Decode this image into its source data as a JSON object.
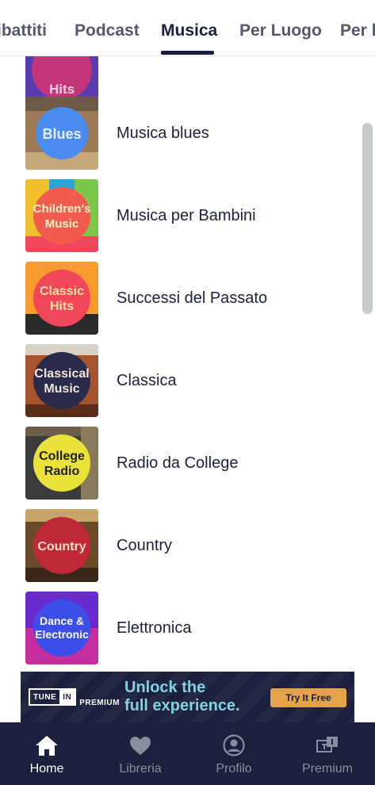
{
  "tabs": {
    "items": [
      {
        "label": "ibattiti",
        "active": false
      },
      {
        "label": "Podcast",
        "active": false
      },
      {
        "label": "Musica",
        "active": true
      },
      {
        "label": "Per Luogo",
        "active": false
      },
      {
        "label": "Per li",
        "active": false
      }
    ]
  },
  "list": {
    "items": [
      {
        "label": "",
        "thumb_text": [
          "Hits"
        ],
        "thumb_colors": [
          "#c2357b",
          "#5b3bb0"
        ]
      },
      {
        "label": "Musica blues",
        "thumb_text": [
          "Blues"
        ],
        "thumb_colors": [
          "#4a8cf0",
          "#9b7a55"
        ]
      },
      {
        "label": "Musica per Bambini",
        "thumb_text": [
          "Children's",
          "Music"
        ],
        "thumb_colors": [
          "#f25c4e",
          "#2aa7d8"
        ]
      },
      {
        "label": "Successi del Passato",
        "thumb_text": [
          "Classic",
          "Hits"
        ],
        "thumb_colors": [
          "#f2465a",
          "#f79b2e"
        ]
      },
      {
        "label": "Classica",
        "thumb_text": [
          "Classical",
          "Music"
        ],
        "thumb_colors": [
          "#2a2b4a",
          "#a5542d"
        ]
      },
      {
        "label": "Radio da College",
        "thumb_text": [
          "College",
          "Radio"
        ],
        "thumb_colors": [
          "#e8e23a",
          "#3b3b3b"
        ]
      },
      {
        "label": "Country",
        "thumb_text": [
          "Country"
        ],
        "thumb_colors": [
          "#c0283a",
          "#6b4a2a"
        ]
      },
      {
        "label": "Elettronica",
        "thumb_text": [
          "Dance &",
          "Electronic"
        ],
        "thumb_colors": [
          "#3b4ee8",
          "#c52e9f"
        ]
      }
    ]
  },
  "banner": {
    "logo_tune": "TUNE",
    "logo_in": "IN",
    "logo_premium": "PREMIUM",
    "headline_line1": "Unlock the",
    "headline_line2": "full experience.",
    "cta": "Try It Free"
  },
  "bottom_nav": {
    "items": [
      {
        "label": "Home",
        "icon": "home-icon",
        "active": true
      },
      {
        "label": "Libreria",
        "icon": "heart-icon",
        "active": false
      },
      {
        "label": "Profilo",
        "icon": "profile-icon",
        "active": false
      },
      {
        "label": "Premium",
        "icon": "premium-icon",
        "active": false
      }
    ]
  },
  "colors": {
    "primary_text": "#1c203c",
    "nav_bg": "#1c203c",
    "banner_accent": "#7fd3e4",
    "cta_bg": "#e4a24a"
  }
}
